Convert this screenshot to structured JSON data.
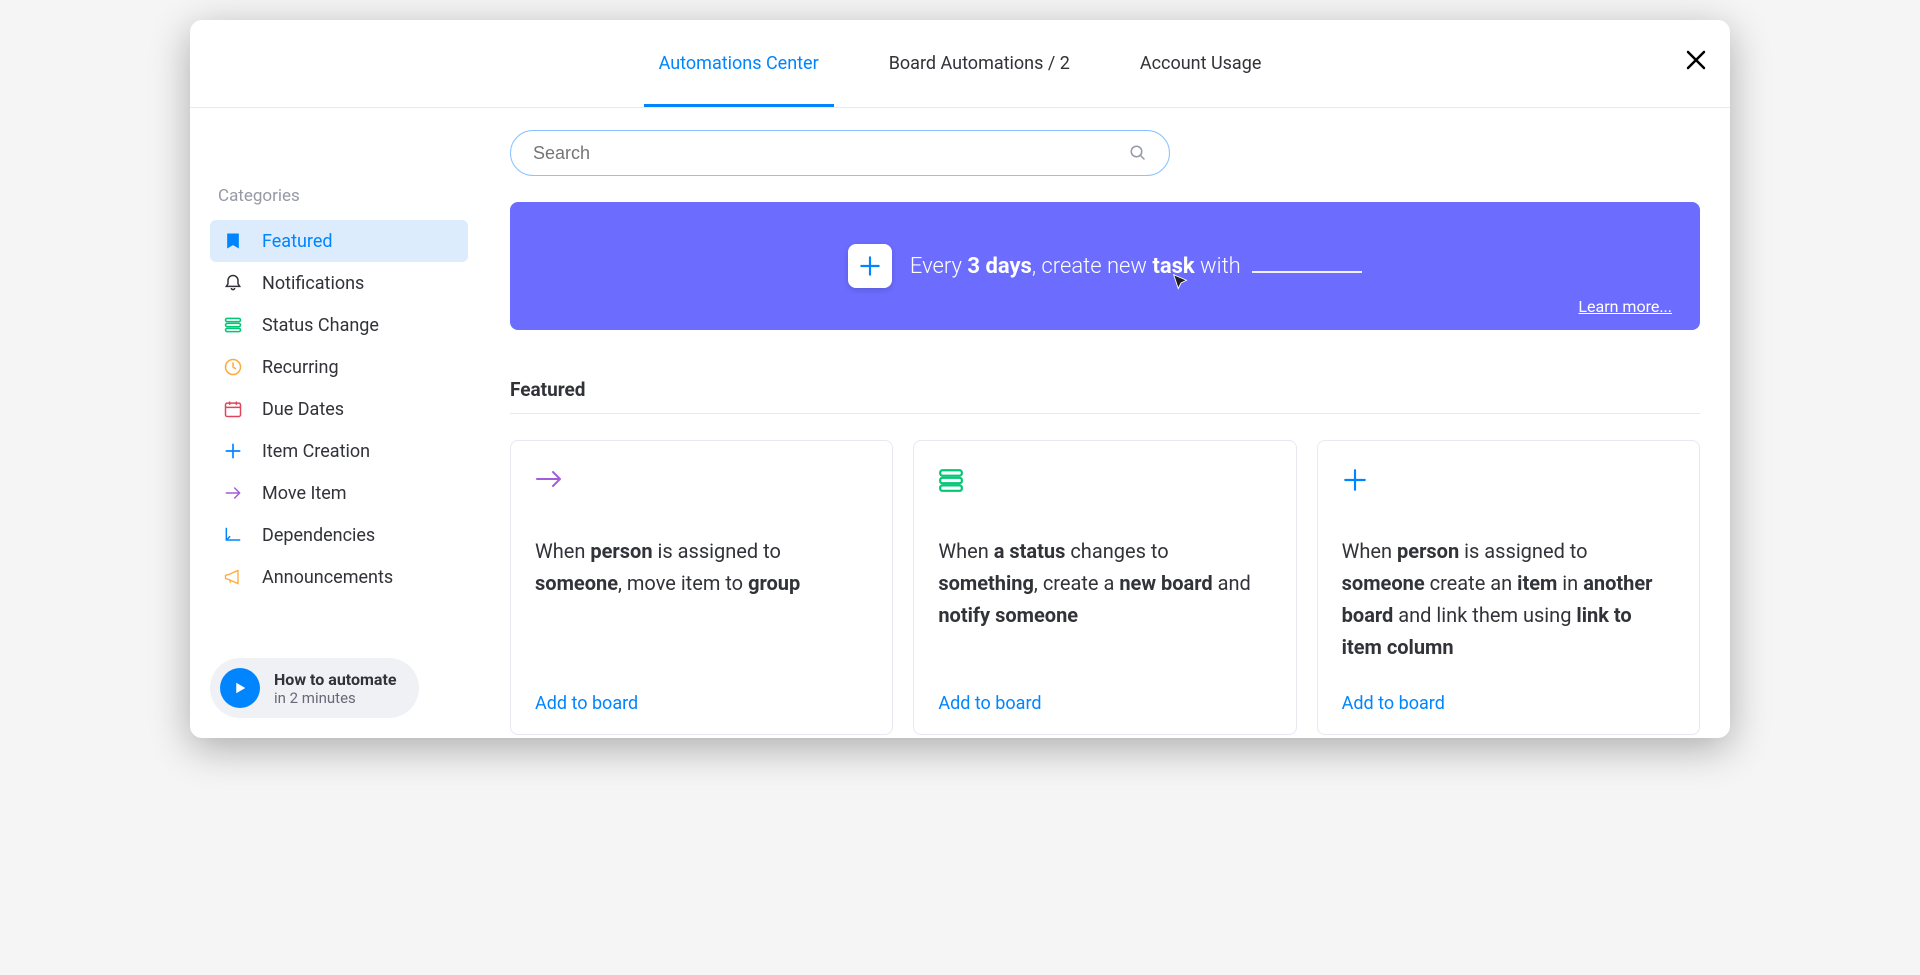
{
  "tabs": {
    "center": "Automations Center",
    "board": "Board Automations / 2",
    "usage": "Account Usage"
  },
  "sidebar": {
    "title": "Categories",
    "items": [
      {
        "label": "Featured"
      },
      {
        "label": "Notifications"
      },
      {
        "label": "Status Change"
      },
      {
        "label": "Recurring"
      },
      {
        "label": "Due Dates"
      },
      {
        "label": "Item Creation"
      },
      {
        "label": "Move Item"
      },
      {
        "label": "Dependencies"
      },
      {
        "label": "Announcements"
      }
    ]
  },
  "howto": {
    "title": "How to automate",
    "subtitle": "in 2 minutes"
  },
  "search": {
    "placeholder": "Search"
  },
  "banner": {
    "prefix": "Every ",
    "bold1": "3 days",
    "mid": ", create new ",
    "bold2": "task",
    "suffix": " with ",
    "learn_more": "Learn more..."
  },
  "section": {
    "title": "Featured"
  },
  "cards": [
    {
      "parts": [
        "When ",
        "person",
        " is assigned to ",
        "someone",
        ", move item to ",
        "group"
      ],
      "add": "Add to board"
    },
    {
      "parts": [
        "When ",
        "a status",
        " changes to ",
        "something",
        ", create a ",
        "new board",
        " and ",
        "notify someone"
      ],
      "add": "Add to board"
    },
    {
      "parts": [
        "When ",
        "person",
        " is assigned to ",
        "someone",
        " create an ",
        "item",
        " in ",
        "another board",
        " and link them using ",
        "link to item column"
      ],
      "add": "Add to board"
    }
  ]
}
